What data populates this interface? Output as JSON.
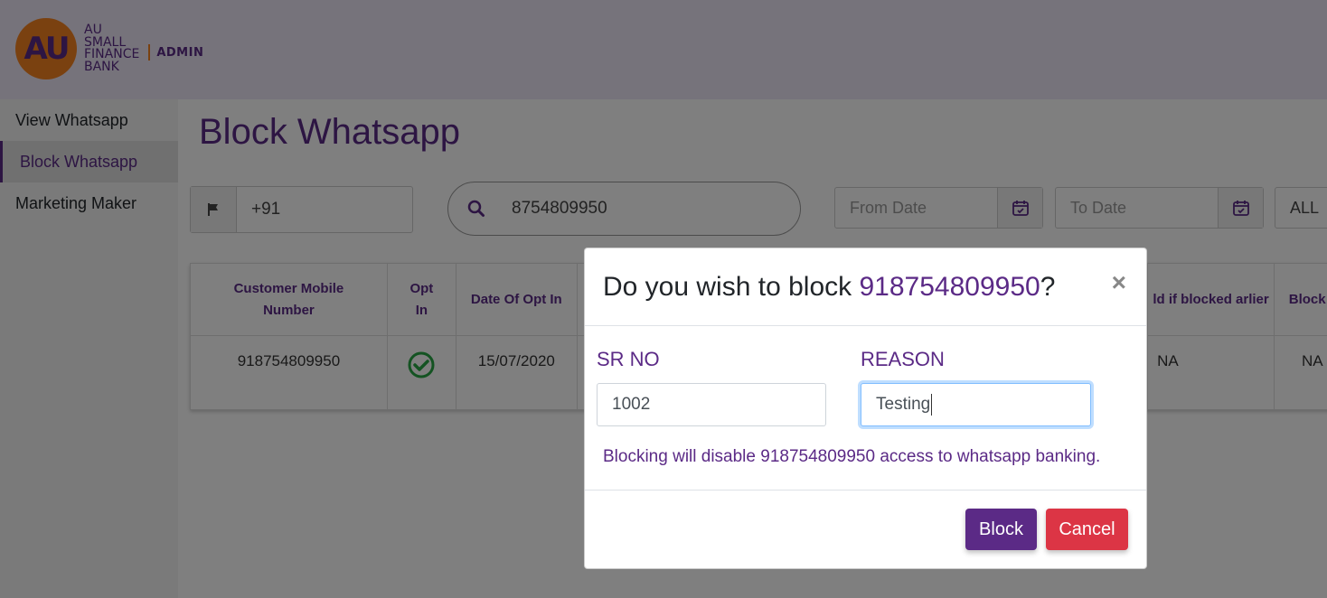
{
  "logo": {
    "mark": "AU",
    "lines": [
      "AU",
      "SMALL",
      "FINANCE",
      "BANK"
    ],
    "admin": "ADMIN"
  },
  "sidebar": {
    "items": [
      {
        "label": "View Whatsapp",
        "active": false
      },
      {
        "label": "Block Whatsapp",
        "active": true
      },
      {
        "label": "Marketing Maker",
        "active": false
      }
    ]
  },
  "page": {
    "title": "Block Whatsapp"
  },
  "filters": {
    "country_code": "+91",
    "search_value": "8754809950",
    "from_date_placeholder": "From Date",
    "to_date_placeholder": "To Date",
    "status_select": "ALL"
  },
  "table": {
    "headers": [
      "Customer Mobile Number",
      "Opt In",
      "Date Of Opt In",
      "",
      "ld if blocked arlier",
      "Block Date"
    ],
    "row": {
      "mobile": "918754809950",
      "date_opt_in": "15/07/2020",
      "blocked_earlier": "NA",
      "block_date": "NA"
    }
  },
  "modal": {
    "title_prefix": "Do you wish to block ",
    "title_number": "918754809950",
    "title_suffix": "?",
    "close": "×",
    "sr_label": "SR NO",
    "sr_value": "1002",
    "reason_label": "REASON",
    "reason_value": "Testing",
    "warning": "Blocking will disable 918754809950 access to whatsapp banking.",
    "block_label": "Block",
    "cancel_label": "Cancel"
  },
  "colors": {
    "brand_purple": "#5b2a86",
    "brand_orange": "#f58220",
    "cancel_red": "#dc3545",
    "check_green": "#28a745"
  }
}
